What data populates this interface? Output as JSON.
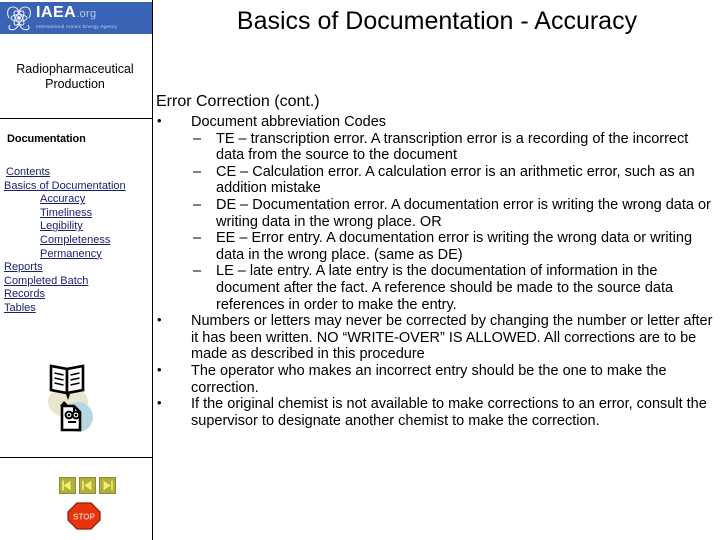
{
  "sidebar": {
    "logo": {
      "emblem_icon": "iaea-atom-laurel-icon",
      "name": "IAEA",
      "domain": ".org",
      "subtitle": "International Atomic Energy Agency",
      "banner_color": "#3b63b5"
    },
    "course_title": "Radiopharmaceutical Production",
    "nav_heading": "Documentation",
    "nav_items": [
      {
        "label": "Contents",
        "indent": 0
      },
      {
        "label": "Basics of Documentation",
        "indent": 1
      },
      {
        "label": "Accuracy",
        "indent": 2
      },
      {
        "label": "Timeliness",
        "indent": 2
      },
      {
        "label": "Legibility",
        "indent": 2
      },
      {
        "label": "Completeness",
        "indent": 2
      },
      {
        "label": "Permanency",
        "indent": 2
      },
      {
        "label": "Reports",
        "indent": 1
      },
      {
        "label": "Completed Batch",
        "indent": 1
      },
      {
        "label": "Records",
        "indent": 1
      },
      {
        "label": "Tables",
        "indent": 1
      }
    ],
    "link_color": "#171f70",
    "reading_icon": "open-book-to-document-icon",
    "buttons": [
      {
        "name": "first-slide-button",
        "icon": "first-arrow-icon"
      },
      {
        "name": "previous-slide-button",
        "icon": "previous-arrow-icon"
      },
      {
        "name": "next-slide-button",
        "icon": "next-arrow-icon"
      }
    ],
    "stop_button": {
      "label": "STOP",
      "icon": "stop-octagon-icon",
      "color": "#e8340c"
    }
  },
  "main": {
    "title": "Basics of Documentation - Accuracy",
    "section_heading": "Error Correction (cont.)",
    "bullets": [
      {
        "marker": "•",
        "text": "Document abbreviation Codes",
        "children": [
          {
            "marker": "–",
            "text": "TE – transcription error.  A transcription error is a recording of the incorrect data from the source to the document"
          },
          {
            "marker": "–",
            "text": "CE – Calculation error.  A calculation error is an arithmetic error, such as an addition mistake"
          },
          {
            "marker": "–",
            "text": "DE – Documentation error.  A documentation error is writing the wrong data or writing data in the wrong place. OR"
          },
          {
            "marker": "–",
            "text": "EE – Error entry.  A documentation error is writing the wrong data or writing data in the wrong place. (same as DE)"
          },
          {
            "marker": "–",
            "text": "LE – late entry.  A late entry is the documentation of information in the document after the fact.  A reference should be made to the source data references in order to make the entry."
          }
        ]
      },
      {
        "marker": "•",
        "text": "Numbers or letters may never be corrected by changing the number or letter after it has been written.  NO “WRITE-OVER” IS ALLOWED.  All corrections are to be made as described in this procedure",
        "children": []
      },
      {
        "marker": "•",
        "text": "The operator who makes an incorrect entry should be the one to make the correction.",
        "children": []
      },
      {
        "marker": "•",
        "text": "If the original chemist is not available to make corrections to an error, consult the supervisor to designate another chemist to make the correction.",
        "children": []
      }
    ]
  }
}
